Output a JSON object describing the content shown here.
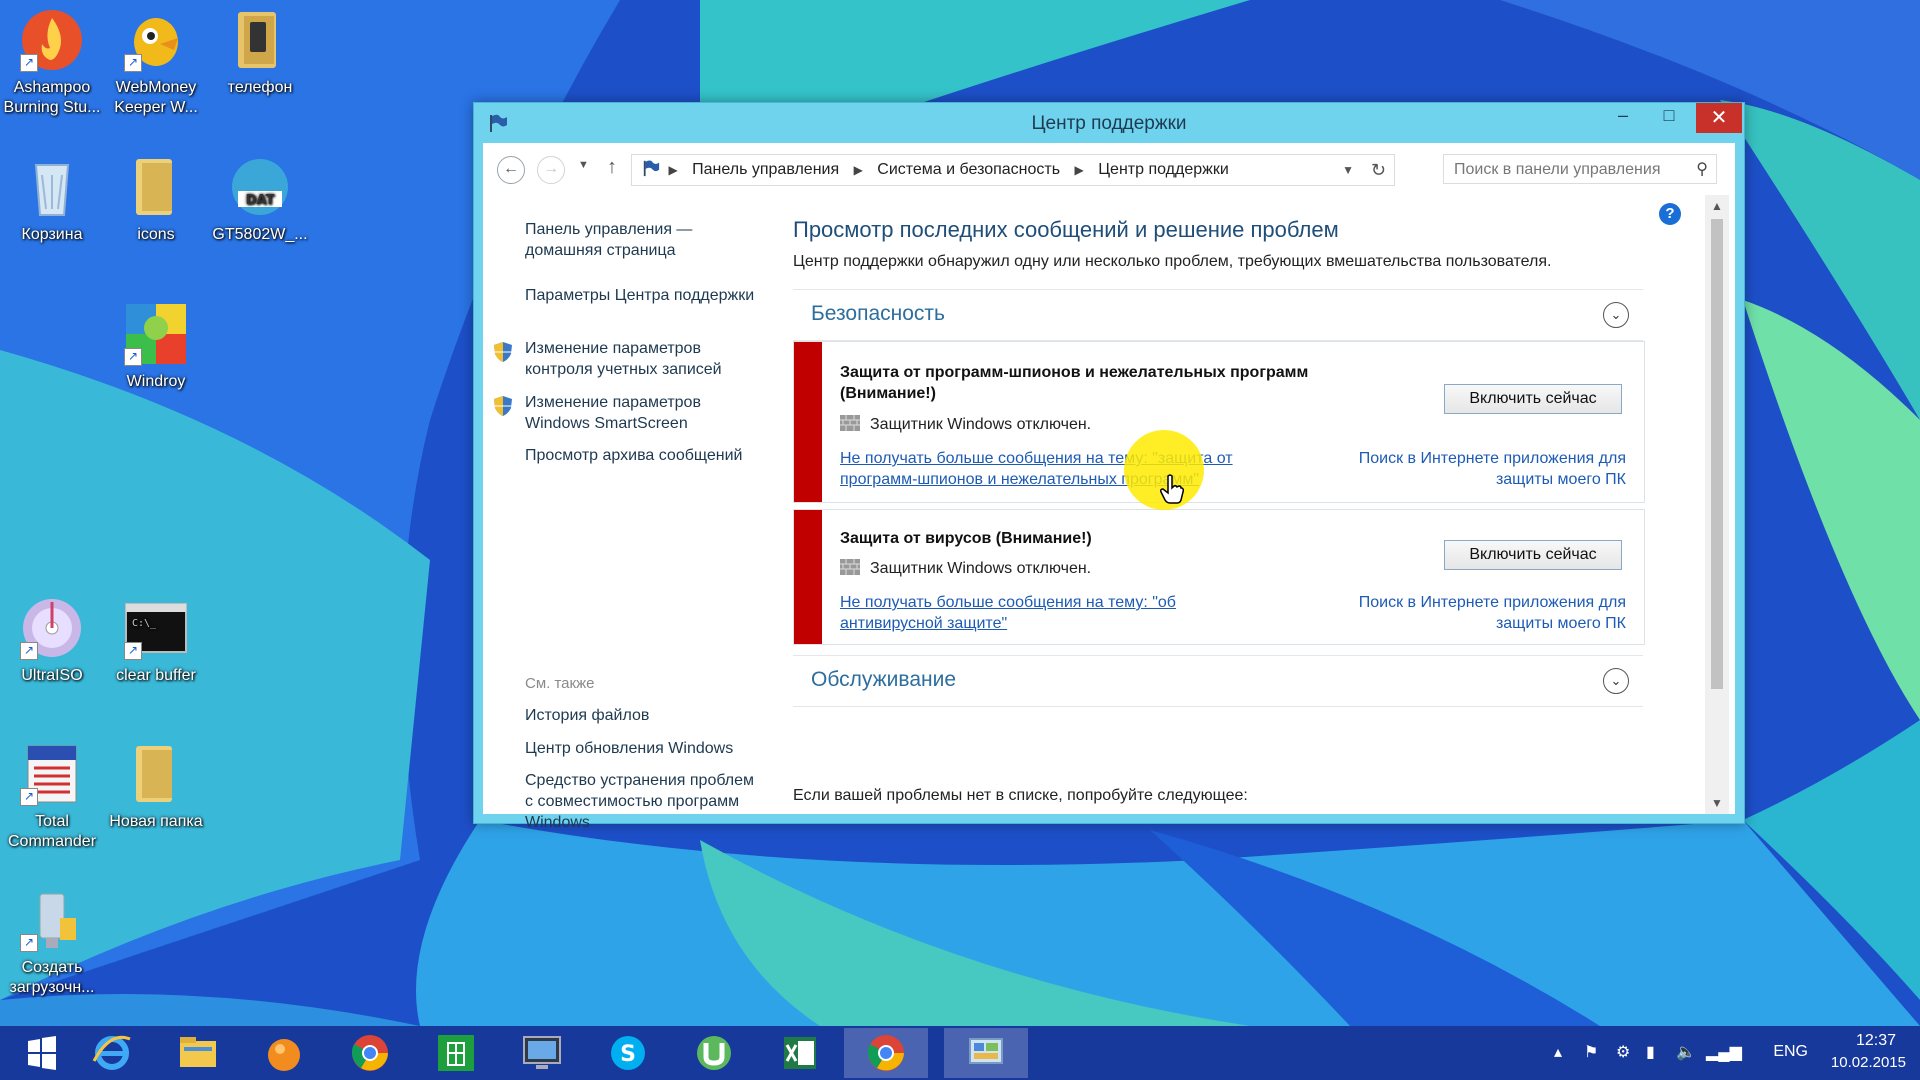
{
  "desktop": {
    "icons": [
      {
        "label": "Ashampoo Burning Stu...",
        "icon": "ashampoo-flame-icon"
      },
      {
        "label": "WebMoney Keeper W...",
        "icon": "webmoney-icon"
      },
      {
        "label": "телефон",
        "icon": "folder-icon"
      },
      {
        "label": "Корзина",
        "icon": "recycle-bin-icon"
      },
      {
        "label": "icons",
        "icon": "folder-icon"
      },
      {
        "label": "GT5802W_...",
        "icon": "dat-file-icon"
      },
      {
        "label": "Windroy",
        "icon": "windroy-icon"
      },
      {
        "label": "UltraISO",
        "icon": "ultraiso-disc-icon"
      },
      {
        "label": "clear buffer",
        "icon": "console-icon"
      },
      {
        "label": "Total Commander",
        "icon": "total-commander-icon"
      },
      {
        "label": "Новая папка",
        "icon": "folder-icon"
      },
      {
        "label": "Создать загрузочн...",
        "icon": "usb-drive-icon"
      }
    ]
  },
  "window": {
    "title": "Центр поддержки",
    "controls": {
      "minimize": "–",
      "maximize": "□",
      "close": "✕"
    }
  },
  "navbar": {
    "breadcrumbs": [
      "Панель управления",
      "Система и безопасность",
      "Центр поддержки"
    ],
    "search_placeholder": "Поиск в панели управления"
  },
  "leftpane": {
    "home_link": "Панель управления — домашняя страница",
    "settings_link": "Параметры Центра поддержки",
    "uac_link": "Изменение параметров контроля учетных записей",
    "smartscreen_link": "Изменение параметров Windows SmartScreen",
    "archive_link": "Просмотр архива сообщений",
    "see_also": "См. также",
    "history_link": "История файлов",
    "update_link": "Центр обновления Windows",
    "compat_link": "Средство устранения проблем с совместимостью программ Windows"
  },
  "main": {
    "title": "Просмотр последних сообщений и решение проблем",
    "description": "Центр поддержки обнаружил одну или несколько проблем, требующих вмешательства пользователя.",
    "security_section": "Безопасность",
    "maintenance_section": "Обслуживание",
    "bottom_note": "Если вашей проблемы нет в списке, попробуйте следующее:",
    "alerts": [
      {
        "title": "Защита от программ-шпионов и нежелательных программ (Внимание!)",
        "status": "Защитник Windows отключен.",
        "dismiss_link": "Не получать больше сообщения на тему: \"защита от программ-шпионов и нежелательных программ\"",
        "search_link": "Поиск в Интернете приложения для защиты моего ПК",
        "button": "Включить сейчас",
        "color": "#c00000"
      },
      {
        "title": "Защита от вирусов  (Внимание!)",
        "status": "Защитник Windows отключен.",
        "dismiss_link": "Не получать больше сообщения на тему: \"об антивирусной защите\"",
        "search_link": "Поиск в Интернете приложения для защиты моего ПК",
        "button": "Включить сейчас",
        "color": "#c00000"
      }
    ]
  },
  "taskbar": {
    "items": [
      "start-icon",
      "internet-explorer-icon",
      "file-explorer-icon",
      "orange-app-icon",
      "chrome-icon",
      "store-icon",
      "monitor-app-icon",
      "skype-icon",
      "utorrent-icon",
      "excel-icon",
      "chrome-icon",
      "control-panel-icon"
    ],
    "language": "ENG",
    "time": "12:37",
    "date": "10.02.2015"
  },
  "colors": {
    "window_frame": "#6fd3ee",
    "alert_bar": "#c00000",
    "link": "#1d5bb5",
    "heading": "#1f4e79"
  }
}
